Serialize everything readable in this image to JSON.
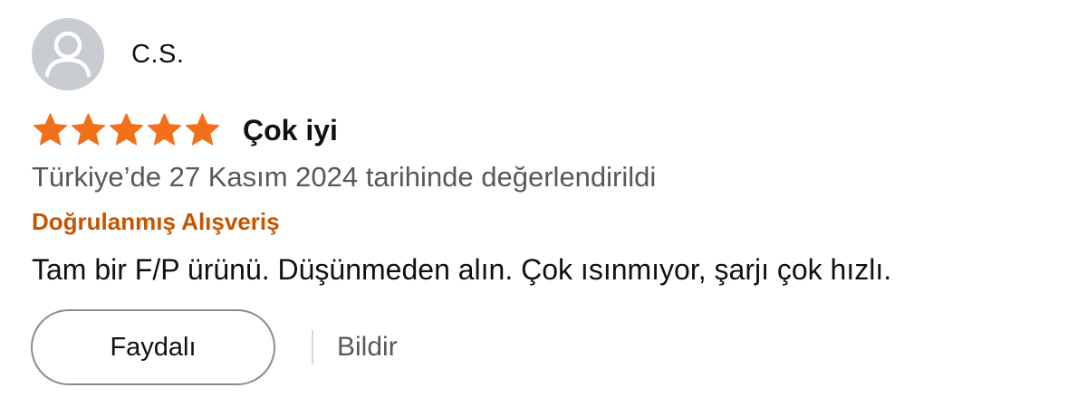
{
  "reviewer": {
    "name": "C.S.",
    "avatar_icon": "user-silhouette-icon"
  },
  "rating": {
    "stars": 5,
    "max": 5,
    "star_color": "#f3701b"
  },
  "review": {
    "title": "Çok iyi",
    "date_text": "Türkiye’de 27 Kasım 2024 tarihinde değerlendirildi",
    "verified_label": "Doğrulanmış Alışveriş",
    "body": "Tam bir F/P ürünü. Düşünmeden alın. Çok ısınmıyor, şarjı çok hızlı."
  },
  "actions": {
    "helpful_label": "Faydalı",
    "report_label": "Bildir"
  },
  "colors": {
    "verified": "#c45500",
    "muted_text": "#565959",
    "avatar_bg": "#c9cdd1"
  }
}
